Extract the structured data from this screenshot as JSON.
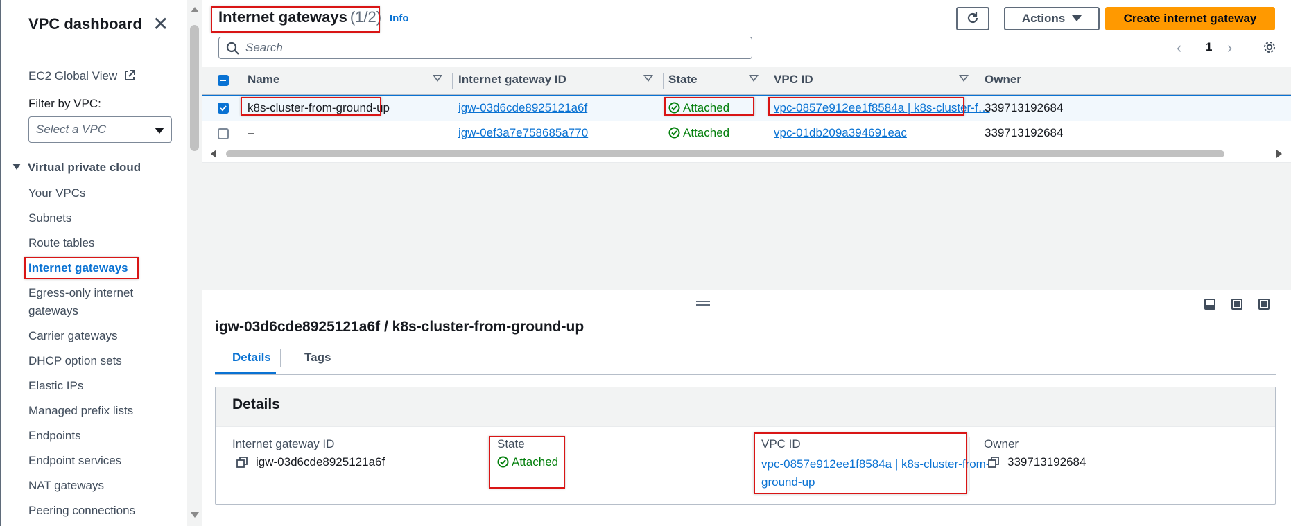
{
  "sidebar": {
    "title": "VPC dashboard",
    "close_icon": "close-icon",
    "ec2_global_view": "EC2 Global View",
    "filter_label": "Filter by VPC:",
    "filter_placeholder": "Select a VPC",
    "section_title": "Virtual private cloud",
    "items": [
      {
        "label": "Your VPCs"
      },
      {
        "label": "Subnets"
      },
      {
        "label": "Route tables"
      },
      {
        "label": "Internet gateways",
        "active": true
      },
      {
        "label": "Egress-only internet gateways"
      },
      {
        "label": "Carrier gateways"
      },
      {
        "label": "DHCP option sets"
      },
      {
        "label": "Elastic IPs"
      },
      {
        "label": "Managed prefix lists"
      },
      {
        "label": "Endpoints"
      },
      {
        "label": "Endpoint services"
      },
      {
        "label": "NAT gateways"
      },
      {
        "label": "Peering connections"
      }
    ]
  },
  "header": {
    "title": "Internet gateways",
    "count": "(1/2)",
    "info_link": "Info",
    "actions_label": "Actions",
    "create_label": "Create internet gateway",
    "search_placeholder": "Search",
    "page_number": "1"
  },
  "table": {
    "columns": [
      "Name",
      "Internet gateway ID",
      "State",
      "VPC ID",
      "Owner"
    ],
    "rows": [
      {
        "selected": true,
        "name": "k8s-cluster-from-ground-up",
        "igw_id": "igw-03d6cde8925121a6f",
        "state": "Attached",
        "vpc_id": "vpc-0857e912ee1f8584a | k8s-cluster-f…",
        "owner": "339713192684"
      },
      {
        "selected": false,
        "name": "–",
        "igw_id": "igw-0ef3a7e758685a770",
        "state": "Attached",
        "vpc_id": "vpc-01db209a394691eac",
        "owner": "339713192684"
      }
    ]
  },
  "detail": {
    "title": "igw-03d6cde8925121a6f / k8s-cluster-from-ground-up",
    "tabs": [
      "Details",
      "Tags"
    ],
    "section_heading": "Details",
    "fields": {
      "igw_label": "Internet gateway ID",
      "igw_value": "igw-03d6cde8925121a6f",
      "state_label": "State",
      "state_value": "Attached",
      "vpc_label": "VPC ID",
      "vpc_value_line1": "vpc-0857e912ee1f8584a | k8s-cluster-from-",
      "vpc_value_line2": "ground-up",
      "owner_label": "Owner",
      "owner_value": "339713192684"
    }
  },
  "colors": {
    "accent": "#0972d3",
    "primary_button": "#ff9900",
    "success": "#037f0c",
    "highlight": "#d91515"
  }
}
